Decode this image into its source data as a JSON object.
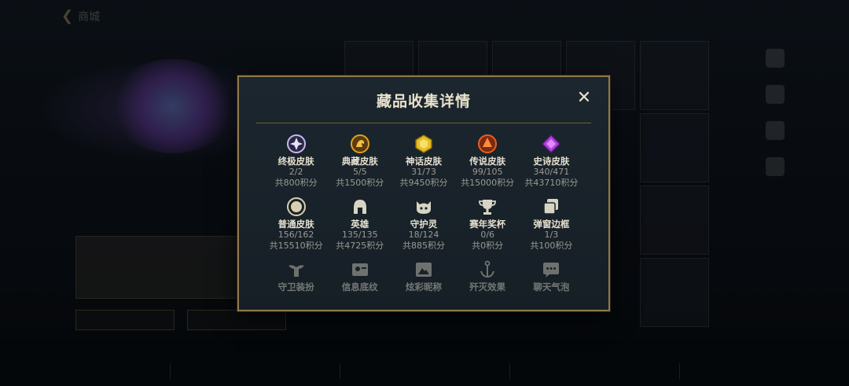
{
  "background": {
    "back_label": "商城"
  },
  "modal": {
    "title": "藏品收集详情",
    "close_symbol": "✕",
    "items": [
      {
        "name": "终极皮肤",
        "count": "2/2",
        "score": "共800积分",
        "icon": "ultimate-skin-icon",
        "color": "#c9b8f0"
      },
      {
        "name": "典藏皮肤",
        "count": "5/5",
        "score": "共1500积分",
        "icon": "collector-skin-icon",
        "color": "#e0a020"
      },
      {
        "name": "神话皮肤",
        "count": "31/73",
        "score": "共9450积分",
        "icon": "mythic-skin-icon",
        "color": "#e8c020"
      },
      {
        "name": "传说皮肤",
        "count": "99/105",
        "score": "共15000积分",
        "icon": "legend-skin-icon",
        "color": "#e86020"
      },
      {
        "name": "史诗皮肤",
        "count": "340/471",
        "score": "共43710积分",
        "icon": "epic-skin-icon",
        "color": "#b040e0"
      },
      {
        "name": "普通皮肤",
        "count": "156/162",
        "score": "共15510积分",
        "icon": "normal-skin-icon",
        "color": "#d8cfb0"
      },
      {
        "name": "英雄",
        "count": "135/135",
        "score": "共4725积分",
        "icon": "hero-helmet-icon",
        "color": "#d8d4c4"
      },
      {
        "name": "守护灵",
        "count": "18/124",
        "score": "共885积分",
        "icon": "guardian-spirit-icon",
        "color": "#d8d4c4"
      },
      {
        "name": "赛年奖杯",
        "count": "0/6",
        "score": "共0积分",
        "icon": "trophy-icon",
        "color": "#d8d4c4"
      },
      {
        "name": "弹窗边框",
        "count": "1/3",
        "score": "共100积分",
        "icon": "popup-frame-icon",
        "color": "#d8d4c4"
      }
    ],
    "partial_items": [
      {
        "name": "守卫装扮",
        "icon": "guard-outfit-icon"
      },
      {
        "name": "信息底纹",
        "icon": "info-shading-icon"
      },
      {
        "name": "炫彩昵称",
        "icon": "colorful-nickname-icon"
      },
      {
        "name": "歼灭效果",
        "icon": "kill-effect-icon"
      },
      {
        "name": "聊天气泡",
        "icon": "chat-bubble-icon"
      }
    ]
  }
}
